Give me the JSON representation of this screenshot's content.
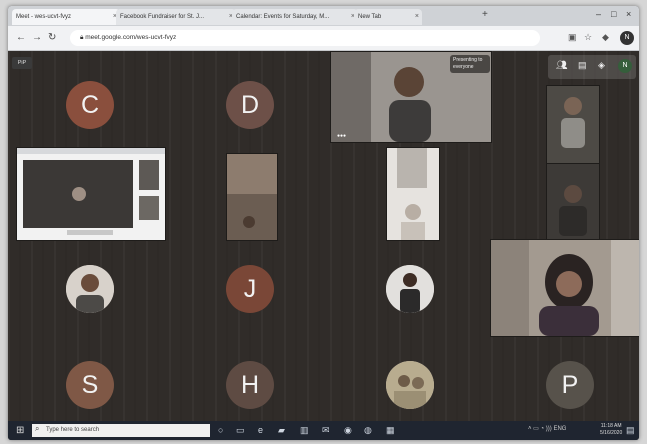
{
  "browser": {
    "tabs": [
      {
        "label": "Meet - wes-ucvt-fvyz"
      },
      {
        "label": "Facebook Fundraiser for St. J..."
      },
      {
        "label": "Calendar: Events for Saturday, M..."
      },
      {
        "label": "New Tab"
      }
    ],
    "url": "meet.google.com/wes-ucvt-fvyz",
    "profile_initial": "N"
  },
  "meeting": {
    "toggle_label": "PiP",
    "presenter_label": "Presenting to everyone",
    "participants": [
      {
        "initial": "C"
      },
      {
        "initial": "D"
      },
      {
        "initial": "J"
      },
      {
        "initial": "S"
      },
      {
        "initial": "H"
      },
      {
        "initial": "P"
      }
    ],
    "top_avatar_initial": "N"
  },
  "taskbar": {
    "search_placeholder": "Type here to search",
    "clock_time": "11:18 AM",
    "clock_date": "5/16/2020"
  },
  "colors": {
    "avatar_c": "#8a4f3d",
    "avatar_d": "#6d5048",
    "avatar_j": "#7a4737",
    "avatar_s": "#7f5846",
    "avatar_h": "#5e4b43",
    "avatar_p": "#57524b"
  }
}
